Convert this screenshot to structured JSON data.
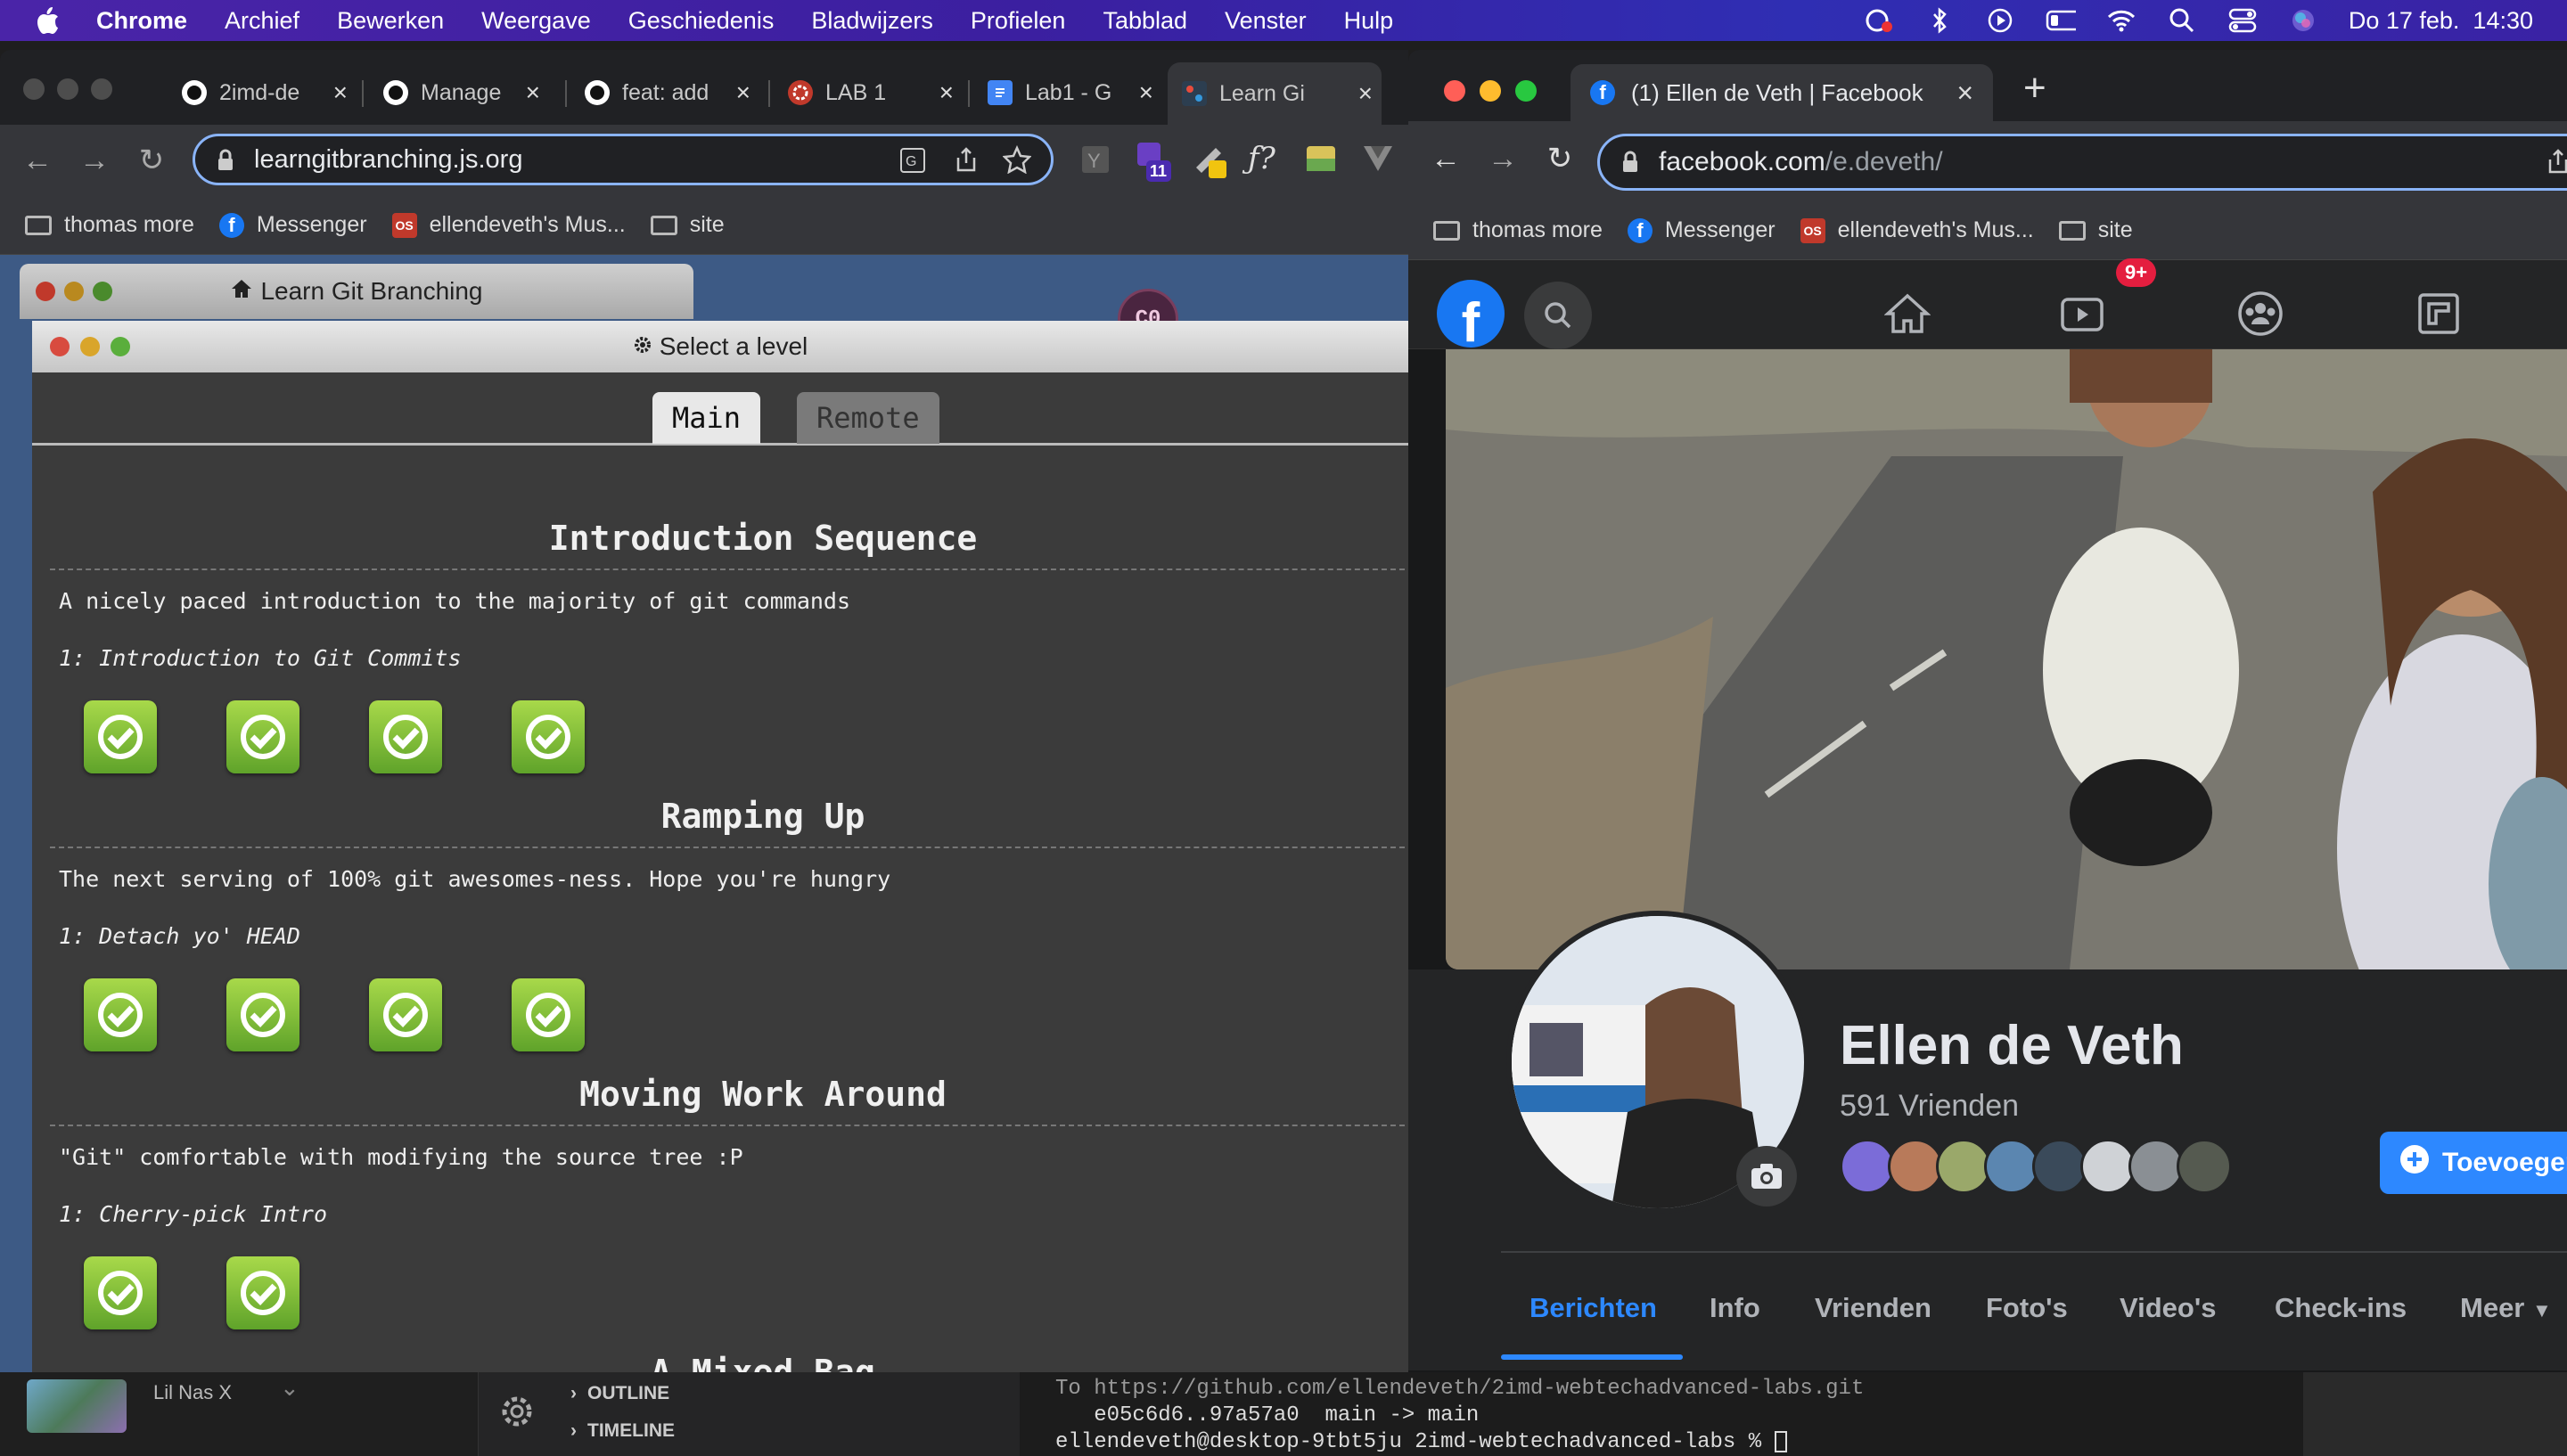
{
  "menubar": {
    "app": "Chrome",
    "items": [
      "Archief",
      "Bewerken",
      "Weergave",
      "Geschiedenis",
      "Bladwijzers",
      "Profielen",
      "Tabblad",
      "Venster",
      "Hulp"
    ],
    "datetime": "Do 17 feb.  14:30"
  },
  "left_chrome": {
    "tabs": [
      "2imd-de",
      "Manage",
      "feat: add",
      "LAB 1",
      "Lab1 - G",
      "Learn Gi"
    ],
    "url": "learngitbranching.js.org",
    "extension_badge": "11",
    "bookmarks": [
      "thomas more",
      "Messenger",
      "ellendeveth's Mus...",
      "site"
    ]
  },
  "git": {
    "window_title": "Learn Git Branching",
    "avatar_label": "C0",
    "dialog_title": "Select a level",
    "tabs": [
      "Main",
      "Remote"
    ],
    "sections": [
      {
        "title": "Introduction Sequence",
        "desc": "A nicely paced introduction to the majority of git commands",
        "sub": "1: Introduction to Git Commits",
        "levels_done": 4
      },
      {
        "title": "Ramping Up",
        "desc": "The next serving of 100% git awesomes-ness. Hope you're hungry",
        "sub": "1: Detach yo' HEAD",
        "levels_done": 4
      },
      {
        "title": "Moving Work Around",
        "desc": "\"Git\" comfortable with modifying the source tree :P",
        "sub": "1: Cherry-pick Intro",
        "levels_done": 2
      },
      {
        "title": "A Mixed Bag"
      }
    ]
  },
  "facebook_chrome": {
    "tab_title": "(1) Ellen de Veth | Facebook",
    "url_domain": "facebook.com",
    "url_path": "/e.deveth/",
    "bookmarks": [
      "thomas more",
      "Messenger",
      "ellendeveth's Mus...",
      "site"
    ]
  },
  "facebook": {
    "watch_badge": "9+",
    "name": "Ellen de Veth",
    "friends": "591 Vrienden",
    "add_button": "Toevoegen",
    "tabs": [
      "Berichten",
      "Info",
      "Vrienden",
      "Foto's",
      "Video's",
      "Check-ins",
      "Meer"
    ],
    "colors": {
      "accent": "#2d88ff",
      "badge": "#e41e3f"
    }
  },
  "desktop_bottom": {
    "music_artist": "Lil Nas X",
    "vscode_sections": [
      "OUTLINE",
      "TIMELINE"
    ],
    "terminal_lines": [
      "To https://github.com/ellendeveth/2imd-webtechadvanced-labs.git",
      "   e05c6d6..97a57a0  main -> main",
      "ellendeveth@desktop-9tbt5ju 2imd-webtechadvanced-labs % "
    ]
  }
}
